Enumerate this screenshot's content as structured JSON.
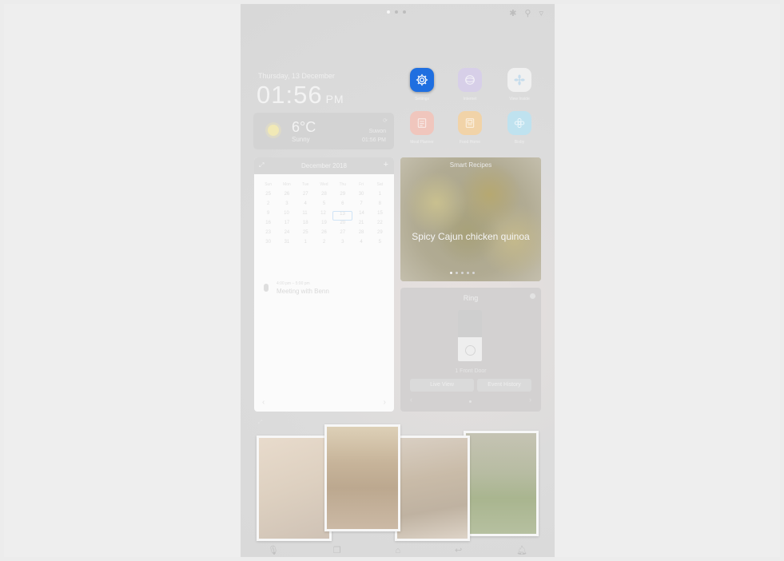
{
  "status": {
    "page_dots": 3,
    "active_page": 0,
    "icons": [
      "bluetooth-icon",
      "location-icon",
      "wifi-icon"
    ]
  },
  "clock": {
    "date": "Thursday, 13 December",
    "time": "01:56",
    "ampm": "PM"
  },
  "weather": {
    "temp": "6°C",
    "condition": "Sunny",
    "location": "Suwon",
    "updated": "01:56 PM"
  },
  "apps": [
    {
      "label": "Settings",
      "icon": "gear-icon",
      "color": "#1f6fe0"
    },
    {
      "label": "Internet",
      "icon": "globe-icon",
      "color": "#d7cfe8"
    },
    {
      "label": "View Inside",
      "icon": "fan-icon",
      "color": "#f0f0f0"
    },
    {
      "label": "Meal Planner",
      "icon": "menu-icon",
      "color": "#f0c6bd"
    },
    {
      "label": "Food Home",
      "icon": "board-icon",
      "color": "#f1d3a8"
    },
    {
      "label": "Bixby",
      "icon": "flower-icon",
      "color": "#bfe2ef"
    }
  ],
  "calendar": {
    "month": "December 2018",
    "weekdays": [
      "Sun",
      "Mon",
      "Tue",
      "Wed",
      "Thu",
      "Fri",
      "Sat"
    ],
    "weeks": [
      [
        "25",
        "26",
        "27",
        "28",
        "29",
        "30",
        "1"
      ],
      [
        "2",
        "3",
        "4",
        "5",
        "6",
        "7",
        "8"
      ],
      [
        "9",
        "10",
        "11",
        "12",
        "13",
        "14",
        "15"
      ],
      [
        "16",
        "17",
        "18",
        "19",
        "20",
        "21",
        "22"
      ],
      [
        "23",
        "24",
        "25",
        "26",
        "27",
        "28",
        "29"
      ],
      [
        "30",
        "31",
        "1",
        "2",
        "3",
        "4",
        "5"
      ]
    ],
    "today": "13",
    "event_time": "4:00 pm – 5:00 pm",
    "event_title": "Meeting with Benn"
  },
  "recipe": {
    "title": "Smart Recipes",
    "name": "Spicy Cajun chicken quinoa",
    "dots": 5
  },
  "ring": {
    "title": "Ring",
    "device": "1 Front Door",
    "live_label": "Live View",
    "history_label": "Event History"
  }
}
